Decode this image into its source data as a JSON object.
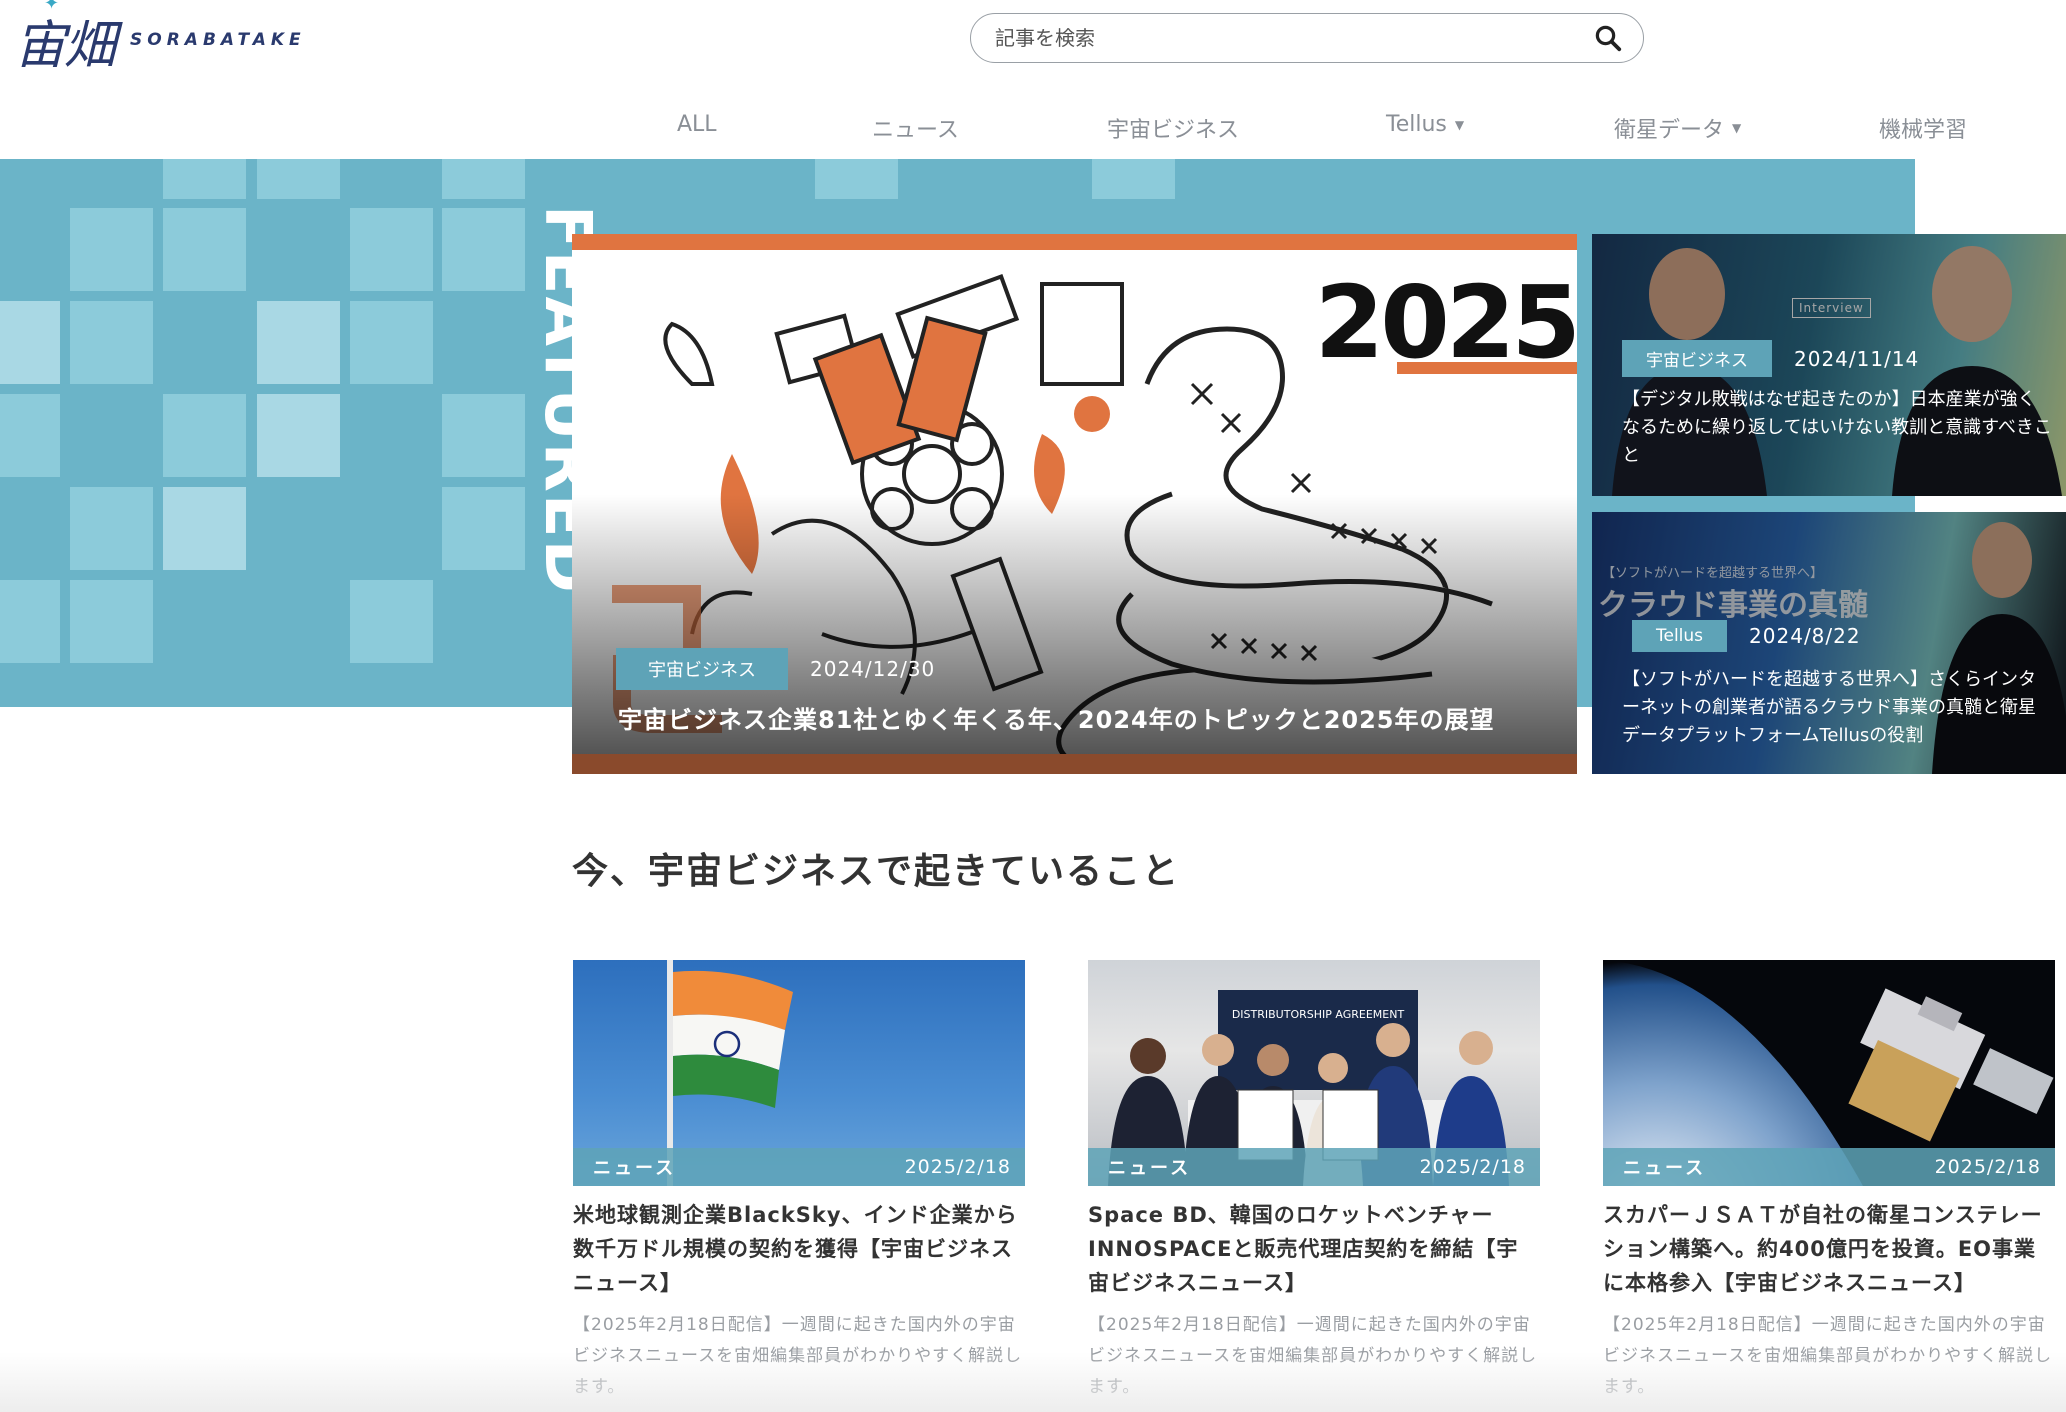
{
  "header": {
    "logo_text": "宙畑",
    "logo_word": "SORABATAKE",
    "search_placeholder": "記事を検索"
  },
  "nav": {
    "items": [
      {
        "label": "ALL"
      },
      {
        "label": "ニュース"
      },
      {
        "label": "宇宙ビジネス"
      },
      {
        "label": "Tellus",
        "dropdown": true
      },
      {
        "label": "衛星データ",
        "dropdown": true
      },
      {
        "label": "機械学習"
      }
    ]
  },
  "featured": {
    "label": "FEATURED",
    "main": {
      "year_art": "2025",
      "tag": "宇宙ビジネス",
      "date": "2024/12/30",
      "title": "宇宙ビジネス企業81社とゆく年くる年、2024年のトピックと2025年の展望"
    },
    "side": [
      {
        "tag": "宇宙ビジネス",
        "date": "2024/11/14",
        "badge": "Interview",
        "title": "【デジタル敗戦はなぜ起きたのか】日本産業が強くなるために繰り返してはいけない教訓と意識すべきこと"
      },
      {
        "tag": "Tellus",
        "date": "2024/8/22",
        "overlay_heading": "クラウド事業の真髄",
        "overlay_kicker": "【ソフトがハードを超越する世界へ】",
        "title": "【ソフトがハードを超越する世界へ】さくらインターネットの創業者が語るクラウド事業の真髄と衛星データプラットフォームTellusの役割"
      }
    ]
  },
  "section": {
    "title": "今、宇宙ビジネスで起きていること"
  },
  "articles": [
    {
      "category": "ニュース",
      "date": "2025/2/18",
      "title": "米地球観測企業BlackSky、インド企業から数千万ドル規模の契約を獲得【宇宙ビジネスニュース】",
      "description": "【2025年2月18日配信】一週間に起きた国内外の宇宙ビジネスニュースを宙畑編集部員がわかりやすく解説します。"
    },
    {
      "category": "ニュース",
      "date": "2025/2/18",
      "image_caption": "DISTRIBUTORSHIP AGREEMENT",
      "title": "Space BD、韓国のロケットベンチャーINNOSPACEと販売代理店契約を締結【宇宙ビジネスニュース】",
      "description": "【2025年2月18日配信】一週間に起きた国内外の宇宙ビジネスニュースを宙畑編集部員がわかりやすく解説します。"
    },
    {
      "category": "ニュース",
      "date": "2025/2/18",
      "title": "スカパーＪＳＡＴが自社の衛星コンステレーション構築へ。約400億円を投資。EO事業に本格参入【宇宙ビジネスニュース】",
      "description": "【2025年2月18日配信】一週間に起きた国内外の宇宙ビジネスニュースを宙畑編集部員がわかりやすく解説します。"
    }
  ],
  "colors": {
    "band": "#6bb4c8",
    "tag": "#5ea3b7",
    "accent_orange": "#e07440",
    "logo": "#2a3a6e"
  }
}
